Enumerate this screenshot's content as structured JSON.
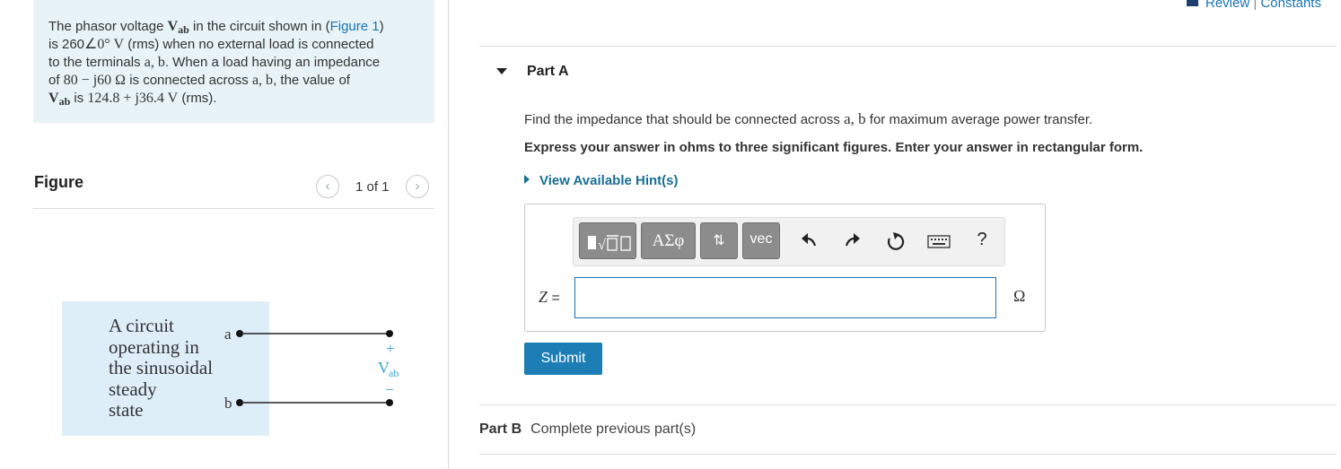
{
  "problem": {
    "t1": "The phasor voltage ",
    "v_main": "V",
    "v_sub": "ab",
    "t2": " in the circuit shown in (",
    "fig_link": "Figure 1",
    "t3": ")",
    "t4": "is 260",
    "angle": "∠0° V",
    "t5": " (rms) when no external load is connected",
    "t6": "to the terminals ",
    "ab": "a, b",
    "t7": ". When a load having an impedance",
    "t8": "of ",
    "imp": "80 − j60 Ω",
    "t9": " is connected across ",
    "t10": ", the value of",
    "t11": " is ",
    "val": "124.8 + j36.4 V",
    "t12": " (rms)."
  },
  "figure": {
    "title": "Figure",
    "pager_text": "1 of 1",
    "prev_icon": "chevron-left-icon",
    "next_icon": "chevron-right-icon",
    "circuit_text": [
      "A circuit",
      "operating in",
      "the sinusoidal",
      "steady",
      "state"
    ],
    "terminal_a": "a",
    "terminal_b": "b",
    "plus": "+",
    "minus": "−",
    "v_label": "V",
    "v_sub": "ab"
  },
  "header": {
    "review": "Review",
    "separator": "|",
    "constants": "Constants"
  },
  "partA": {
    "title": "Part A",
    "question_1": "Find the impedance that should be connected across ",
    "question_ab": "a, b",
    "question_2": " for maximum average power transfer.",
    "instructions": "Express your answer in ohms to three significant figures. Enter your answer in rectangular form.",
    "hint": "View Available Hint(s)",
    "toolbar": {
      "templates_icon": "templates-icon",
      "greek": "ΑΣφ",
      "arrows": "⇅",
      "vec": "vec",
      "undo_icon": "undo-icon",
      "redo_icon": "redo-icon",
      "reset_icon": "reset-icon",
      "keyboard_icon": "keyboard-icon",
      "help": "?"
    },
    "var_label": "Z",
    "equals": "=",
    "input_value": "",
    "unit": "Ω",
    "submit": "Submit"
  },
  "partB": {
    "title": "Part B",
    "status": "Complete previous part(s)"
  },
  "colors": {
    "problem_bg": "#e7f3f6",
    "figure_bg": "#deeef9",
    "link": "#1a73b8",
    "submit_bg": "#1d7db5",
    "toolbar_button": "#8c8c8c"
  }
}
